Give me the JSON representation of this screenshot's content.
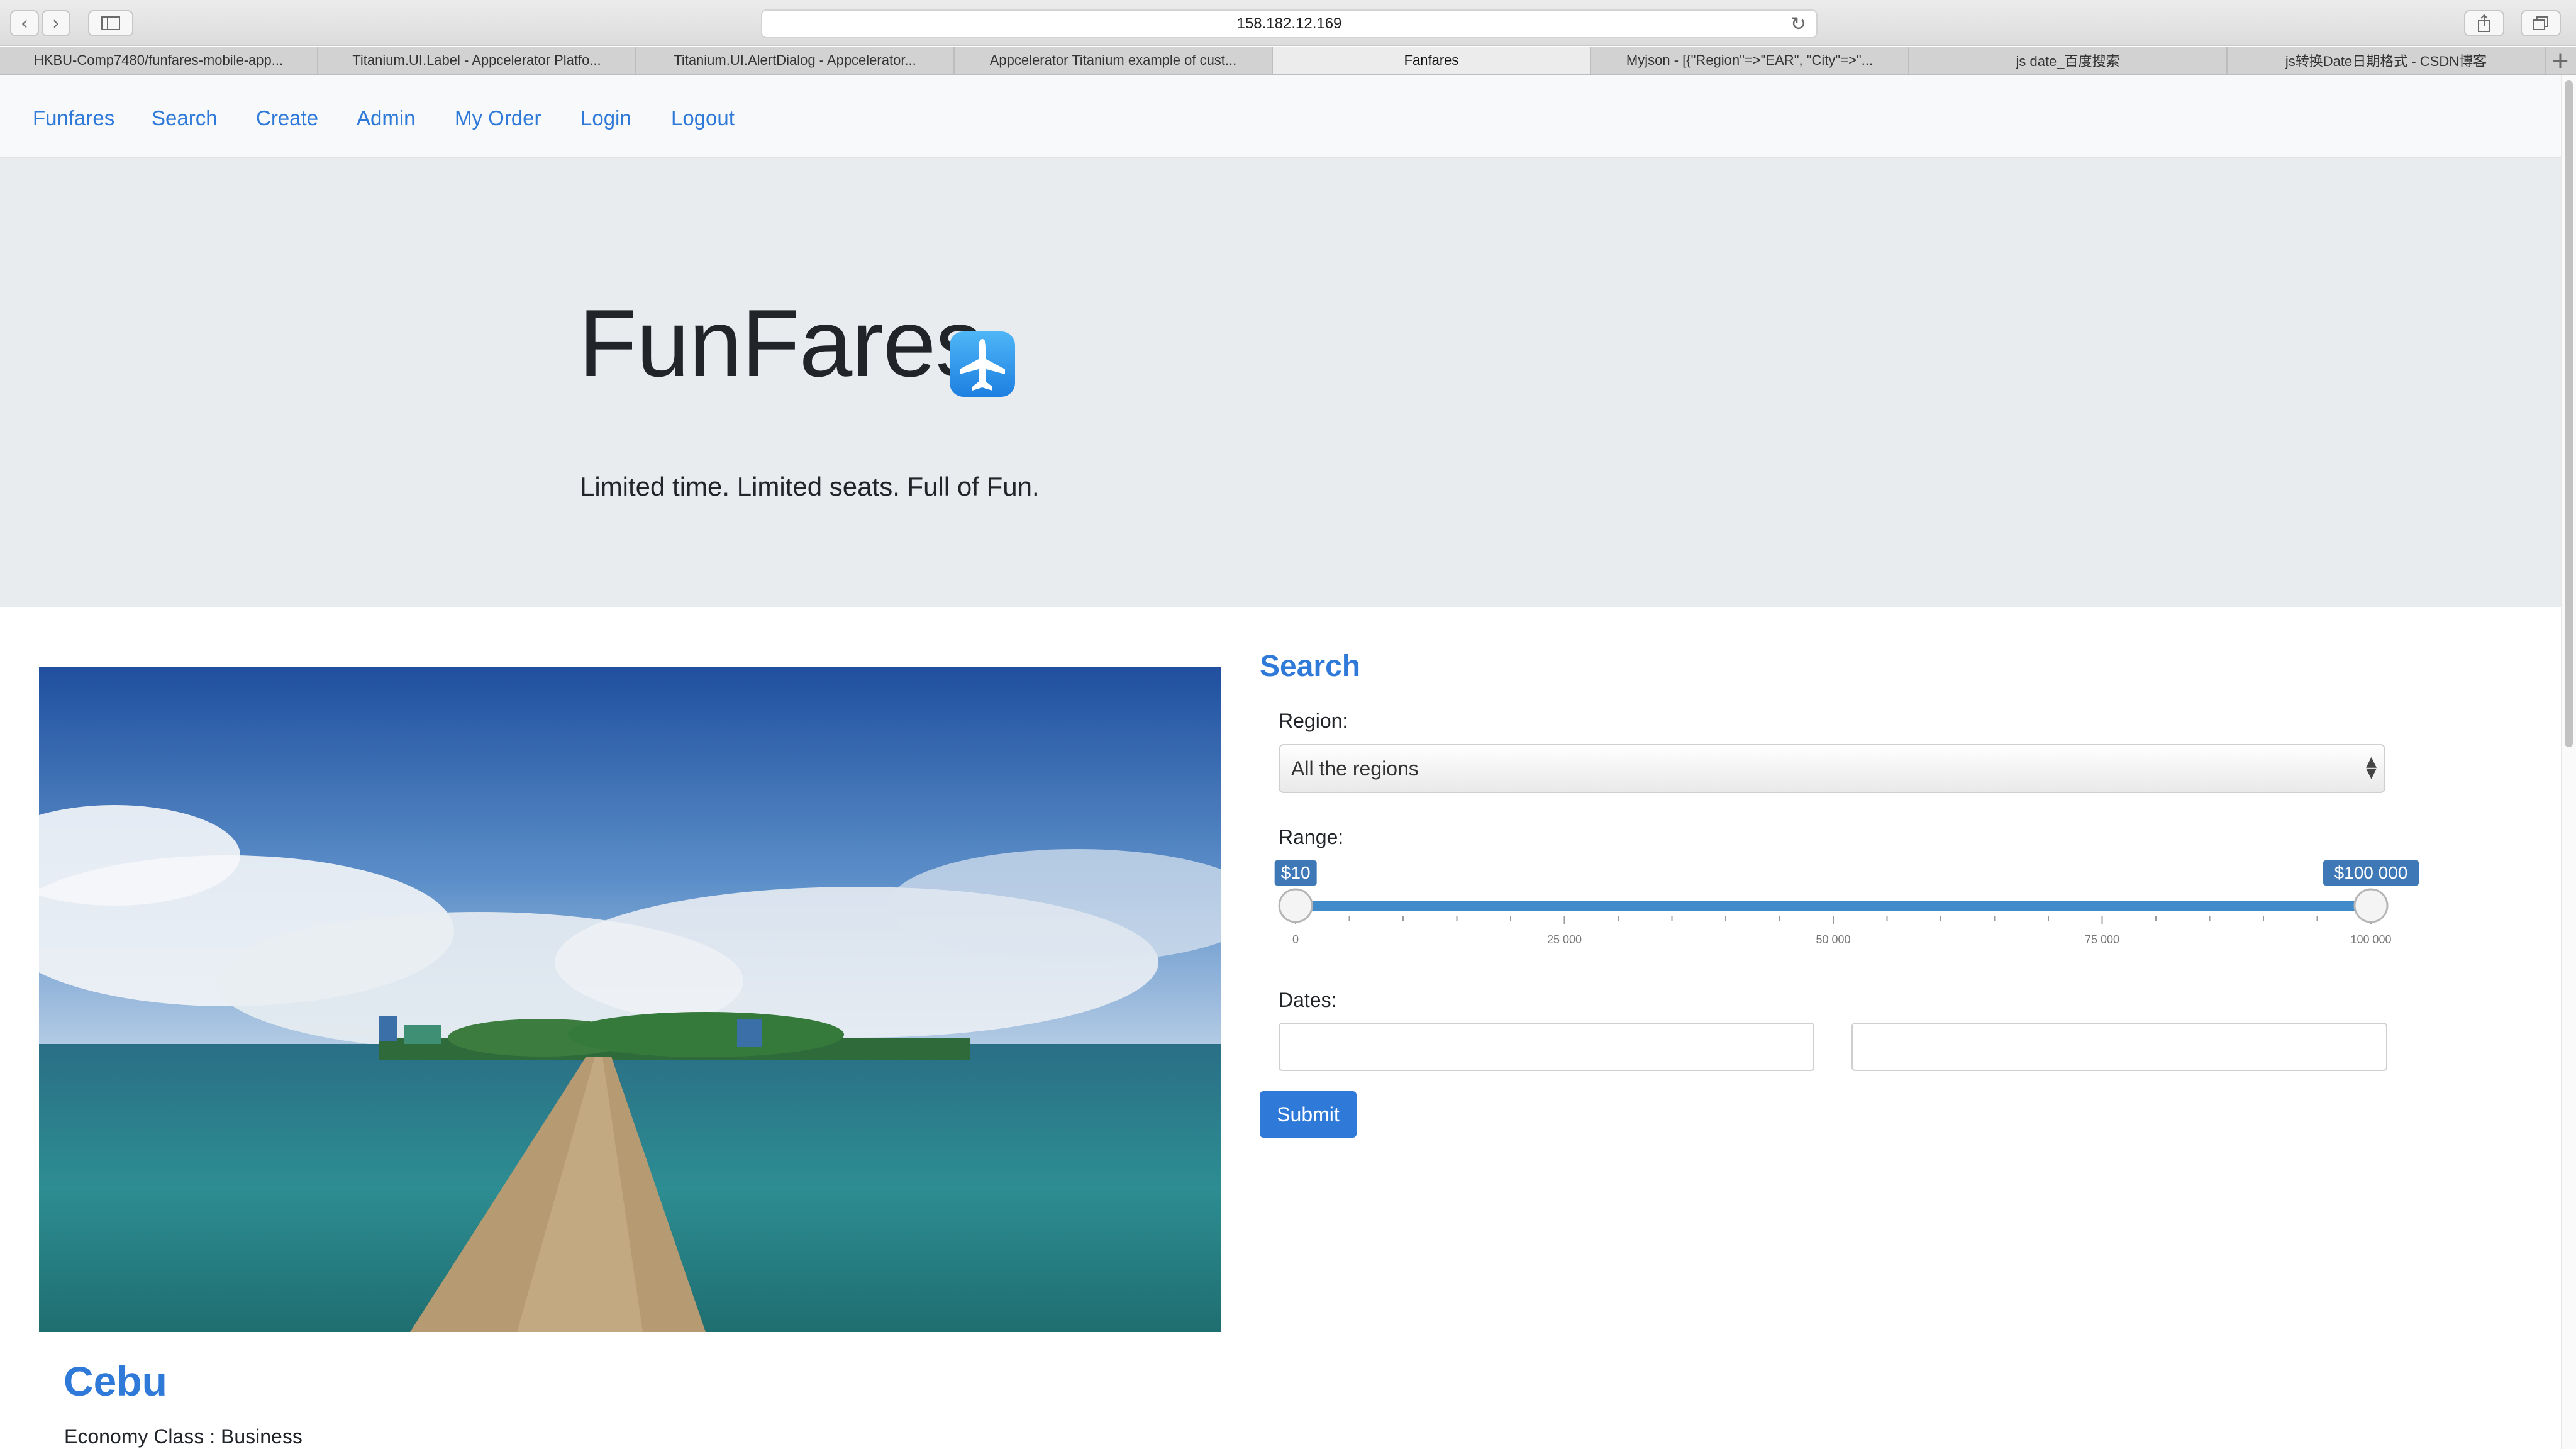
{
  "browser": {
    "url": "158.182.12.169",
    "tabs": [
      {
        "label": "HKBU-Comp7480/funfares-mobile-app...",
        "active": false
      },
      {
        "label": "Titanium.UI.Label - Appcelerator Platfo...",
        "active": false
      },
      {
        "label": "Titanium.UI.AlertDialog - Appcelerator...",
        "active": false
      },
      {
        "label": "Appcelerator Titanium example of cust...",
        "active": false
      },
      {
        "label": "Fanfares",
        "active": true
      },
      {
        "label": "Myjson - [{\"Region\"=>\"EAR\", \"City\"=>\"...",
        "active": false
      },
      {
        "label": "js date_百度搜索",
        "active": false
      },
      {
        "label": "js转换Date日期格式 - CSDN博客",
        "active": false
      }
    ],
    "new_tab_label": "+"
  },
  "nav": {
    "items": [
      "Funfares",
      "Search",
      "Create",
      "Admin",
      "My Order",
      "Login",
      "Logout"
    ]
  },
  "hero": {
    "title": "FunFares",
    "tagline": "Limited time. Limited seats. Full of Fun.",
    "icon": "airplane-app-icon"
  },
  "destination": {
    "name": "Cebu",
    "class_line": "Economy Class : Business",
    "image": "pier-to-island-photo"
  },
  "search": {
    "heading": "Search",
    "region_label": "Region:",
    "region_selected": "All the regions",
    "range_label": "Range:",
    "range_min_label": "$10",
    "range_max_label": "$100 000",
    "range_scale_min": 0,
    "range_scale_max": 100000,
    "range_selected_min": 10,
    "range_selected_max": 100000,
    "range_ticks": [
      "0",
      "25 000",
      "50 000",
      "75 000",
      "100 000"
    ],
    "dates_label": "Dates:",
    "date_from_value": "",
    "date_to_value": "",
    "submit_label": "Submit"
  },
  "colors": {
    "link": "#2f7ad9",
    "jumbotron": "#e9ecef",
    "navbar": "#f8f9fa",
    "slider_bar": "#428bca"
  }
}
